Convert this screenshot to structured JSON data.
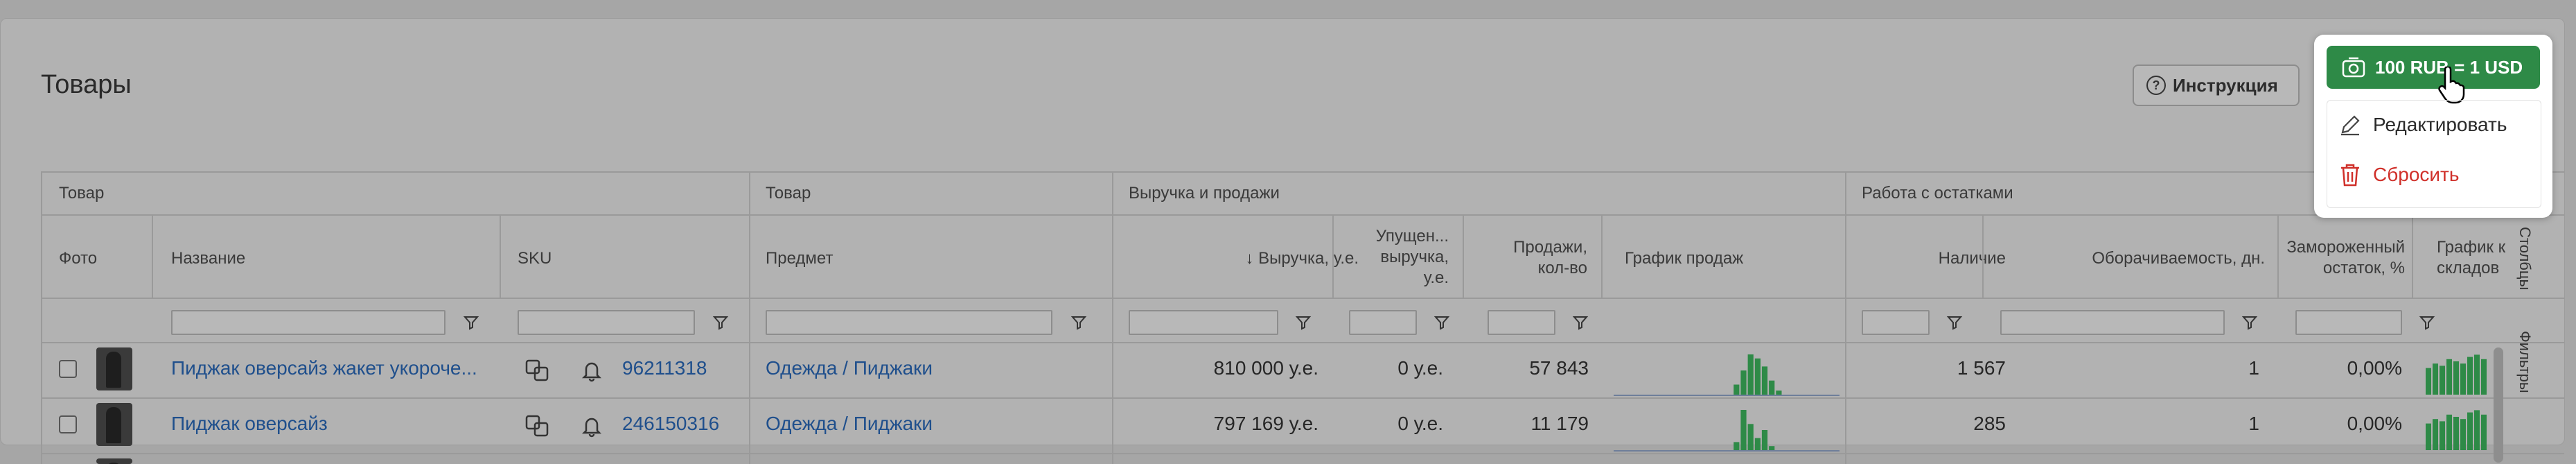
{
  "page": {
    "title": "Товары"
  },
  "header": {
    "instruction_label": "Инструкция",
    "rate_label": "100 RUB = 1 USD"
  },
  "rate_menu": {
    "edit_label": "Редактировать",
    "reset_label": "Сбросить"
  },
  "table": {
    "groups": [
      "Товар",
      "Товар",
      "Выручка и продажи",
      "Работа с остатками"
    ],
    "columns": {
      "photo": "Фото",
      "name": "Название",
      "sku": "SKU",
      "subject": "Предмет",
      "revenue": "↓ Выручка, у.е.",
      "lost_l1": "Упущен...",
      "lost_l2": "выручка,",
      "lost_l3": "у.е.",
      "sales_l1": "Продажи,",
      "sales_l2": "кол-во",
      "sales_chart": "График продаж",
      "stock": "Наличие",
      "turnover": "Оборачиваемость, дн.",
      "frozen_l1": "Замороженный",
      "frozen_l2": "остаток, %",
      "wh_chart_l1": "График к",
      "wh_chart_l2": "складов"
    },
    "rows": [
      {
        "name": "Пиджак оверсайз жакет укороче...",
        "sku": "96211318",
        "subject": "Одежда / Пиджаки",
        "revenue": "810 000 у.е.",
        "lost": "0 у.е.",
        "sales": "57 843",
        "stock": "1 567",
        "turnover": "1",
        "frozen": "0,00%",
        "spark": [
          0,
          0,
          0,
          0,
          0,
          0,
          0,
          0,
          0,
          0,
          0,
          0,
          0,
          0,
          0,
          0,
          0,
          0.25,
          0.6,
          1,
          0.9,
          0.7,
          0.35,
          0.1,
          0,
          0,
          0,
          0,
          0,
          0,
          0,
          0
        ]
      },
      {
        "name": "Пиджак оверсайз",
        "sku": "246150316",
        "subject": "Одежда / Пиджаки",
        "revenue": "797 169 у.е.",
        "lost": "0 у.е.",
        "sales": "11 179",
        "stock": "285",
        "turnover": "1",
        "frozen": "0,00%",
        "spark": [
          0,
          0,
          0,
          0,
          0,
          0,
          0,
          0,
          0,
          0,
          0,
          0,
          0,
          0,
          0,
          0,
          0,
          0.2,
          1,
          0.65,
          0.3,
          0.5,
          0.1,
          0,
          0,
          0,
          0,
          0,
          0,
          0,
          0,
          0
        ]
      }
    ]
  },
  "side_tabs": {
    "columns": "Столбцы",
    "filters": "Фильтры"
  },
  "colors": {
    "accent_green": "#2e8a47",
    "danger_red": "#d0302a",
    "link_blue": "#1f4f8c"
  }
}
